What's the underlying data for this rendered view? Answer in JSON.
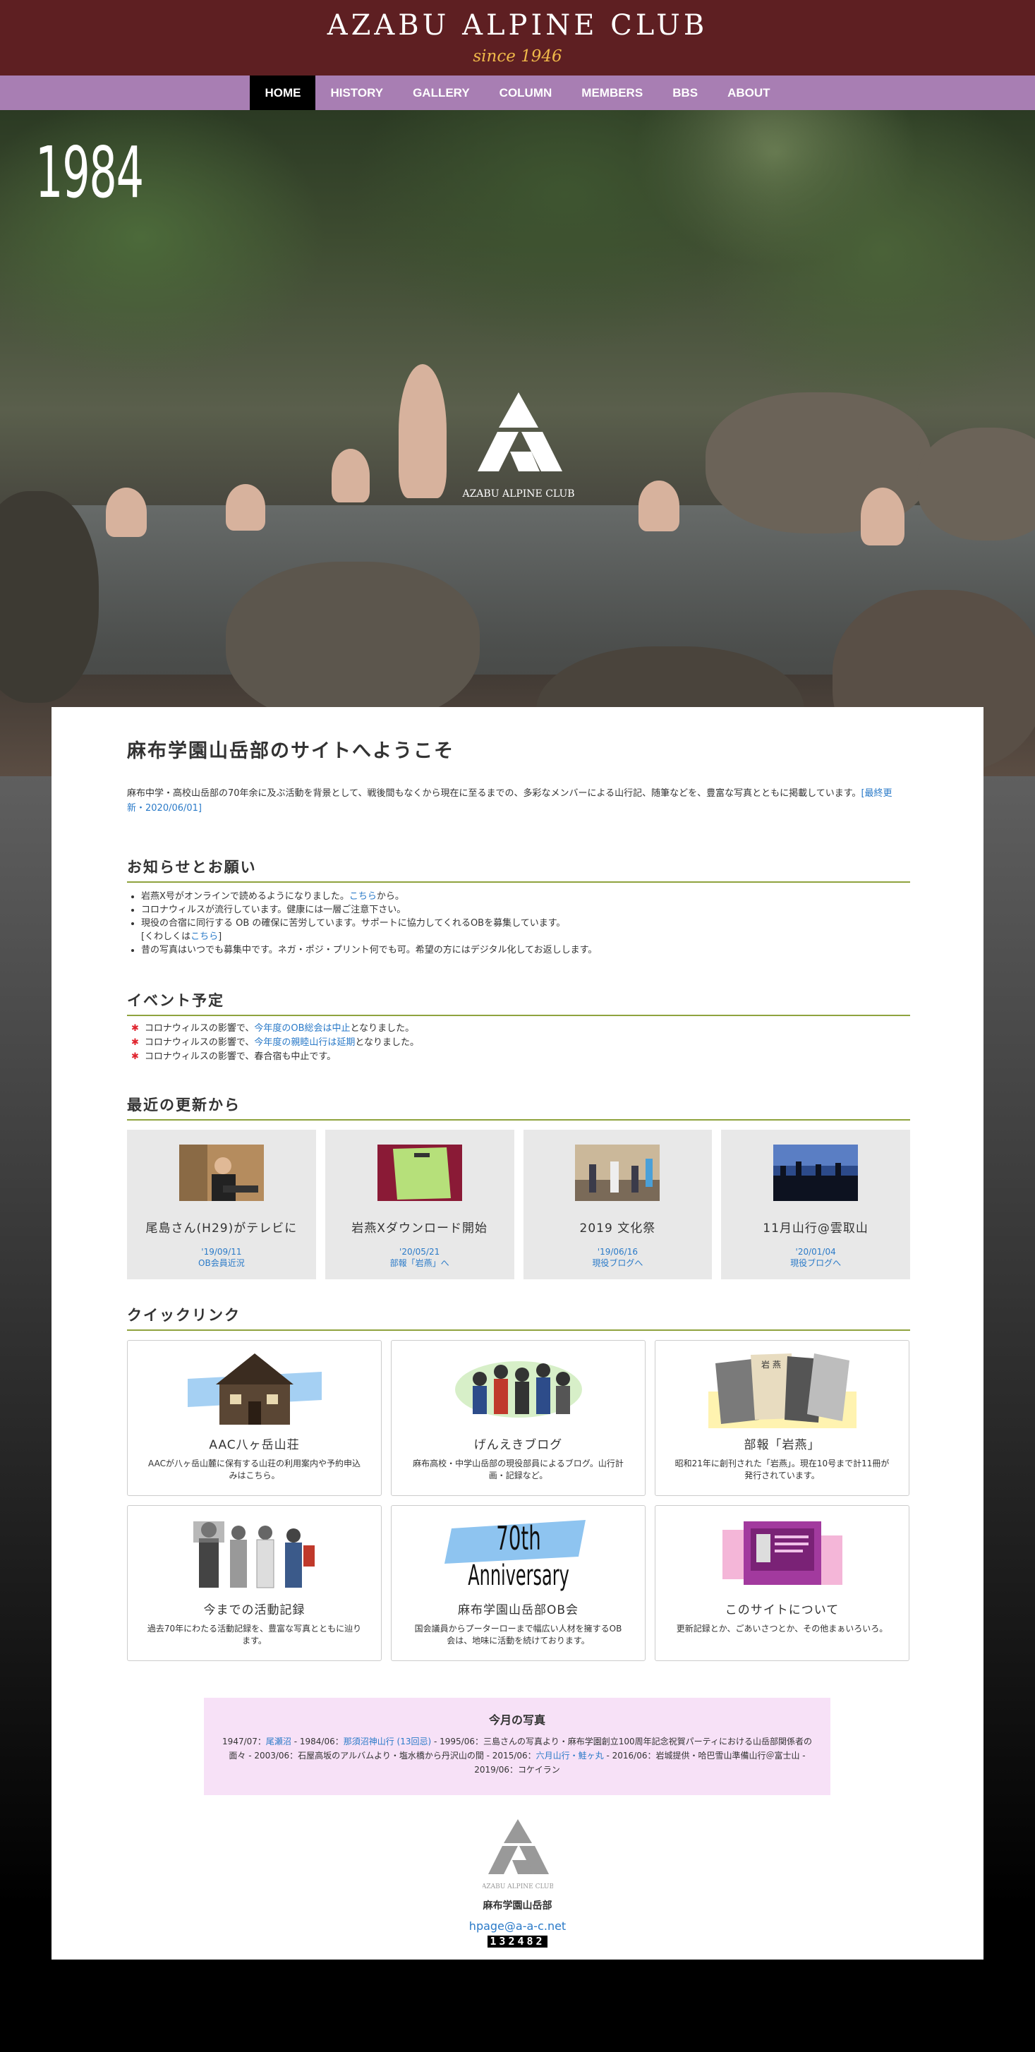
{
  "header": {
    "title": "AZABU ALPINE CLUB",
    "tagline": "since 1946"
  },
  "nav": [
    "HOME",
    "HISTORY",
    "GALLERY",
    "COLUMN",
    "MEMBERS",
    "BBS",
    "ABOUT"
  ],
  "hero": {
    "year": "1984",
    "logo_text": "AZABU ALPINE CLUB"
  },
  "welcome": {
    "title": "麻布学園山岳部のサイトへようこそ",
    "text": "麻布中学・高校山岳部の70年余に及ぶ活動を背景として、戦後間もなくから現在に至るまでの、多彩なメンバーによる山行記、随筆などを、豊富な写真とともに掲載しています。",
    "updated_link": "[最終更新・2020/06/01]"
  },
  "notices": {
    "title": "お知らせとお願い",
    "item1_pre": "岩燕X号がオンラインで読めるようになりました。",
    "item1_link": "こちら",
    "item1_post": "から。",
    "item2": "コロナウィルスが流行しています。健康には一層ご注意下さい。",
    "item3": "現役の合宿に同行する OB の確保に苦労しています。サポートに協力してくれるOBを募集しています。",
    "item3_more_pre": "[くわしくは",
    "item3_more_link": "こちら",
    "item3_more_post": "]",
    "item4": "昔の写真はいつでも募集中です。ネガ・ポジ・プリント何でも可。希望の方にはデジタル化してお返しします。"
  },
  "events": {
    "title": "イベント予定",
    "e1_pre": "コロナウィルスの影響で、",
    "e1_link": "今年度のOB総会は中止",
    "e1_post": "となりました。",
    "e2_pre": "コロナウィルスの影響で、",
    "e2_link": "今年度の親睦山行は延期",
    "e2_post": "となりました。",
    "e3": "コロナウィルスの影響で、春合宿も中止です。"
  },
  "recent": {
    "title": "最近の更新から",
    "items": [
      {
        "title": "尾島さん(H29)がテレビに",
        "date": "'19/09/11",
        "link": "OB会員近況"
      },
      {
        "title": "岩燕Xダウンロード開始",
        "date": "'20/05/21",
        "link": "部報「岩燕」へ"
      },
      {
        "title": "2019 文化祭",
        "date": "'19/06/16",
        "link": "現役ブログへ"
      },
      {
        "title": "11月山行@雲取山",
        "date": "'20/01/04",
        "link": "現役ブログへ"
      }
    ]
  },
  "quick": {
    "title": "クイックリンク",
    "items": [
      {
        "title": "AAC八ヶ岳山荘",
        "desc": "AACが八ヶ岳山麓に保有する山荘の利用案内や予約申込みはこちら。"
      },
      {
        "title": "げんえきブログ",
        "desc": "麻布高校・中学山岳部の現役部員によるブログ。山行計画・記録など。"
      },
      {
        "title": "部報「岩燕」",
        "desc": "昭和21年に創刊された「岩燕」。現在10号まで計11冊が発行されています。"
      },
      {
        "title": "今までの活動記録",
        "desc": "過去70年にわたる活動記録を、豊富な写真とともに辿ります。"
      },
      {
        "title": "麻布学園山岳部OB会",
        "desc": "国会議員からプーターローまで幅広い人材を擁するOB 会は、地味に活動を続けております。"
      },
      {
        "title": "このサイトについて",
        "desc": "更新記録とか、ごあいさつとか、その他まぁいろいろ。"
      }
    ],
    "anniversary_big": "70th",
    "anniversary_small": "Anniversary",
    "booklet_text": "岩 燕"
  },
  "photos": {
    "title": "今月の写真",
    "p1": "1947/07：",
    "l1": "尾瀬沼",
    "p2": " - 1984/06：",
    "l2": "那須沼神山行 (13回忌)",
    "p3": " - 1995/06：三島さんの写真より・麻布学園創立100周年記念祝賀パーティにおける山岳部関係者の面々 - 2003/06：石屋高坂のアルバムより・塩水橋から丹沢山の間 - 2015/06：",
    "l3": "六月山行・鮭ヶ丸",
    "p4": " - 2016/06：岩城提供・哈巴雪山準備山行＠富士山 - 2019/06：コケイラン"
  },
  "footer": {
    "logo_text": "AZABU ALPINE CLUB",
    "name": "麻布学園山岳部",
    "email": "hpage@a-a-c.net",
    "counter": "132482"
  },
  "colors": {
    "header_bg": "#5e1f22",
    "nav_bg": "#a87eb3",
    "accent_gold": "#f0b94a",
    "rule_green": "#8fa33e",
    "link_blue": "#2a7ac8",
    "photo_box_bg": "#f7e1f7"
  }
}
